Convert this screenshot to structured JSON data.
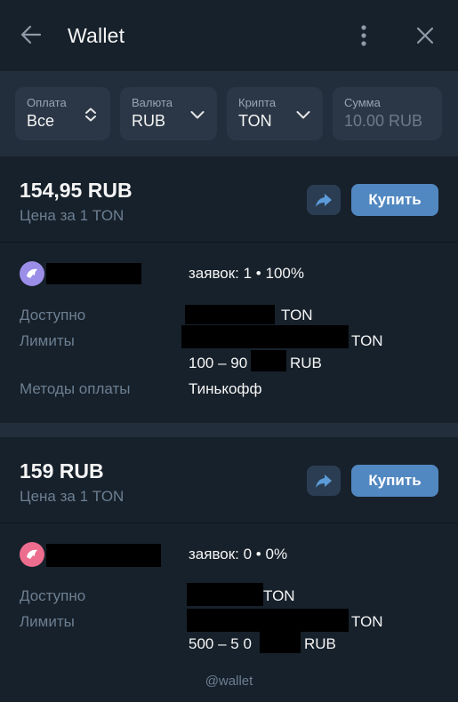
{
  "header": {
    "title": "Wallet"
  },
  "filters": [
    {
      "label": "Оплата",
      "value": "Все"
    },
    {
      "label": "Валюта",
      "value": "RUB"
    },
    {
      "label": "Крипта",
      "value": "TON"
    },
    {
      "label": "Сумма",
      "placeholder": "10.00 RUB"
    }
  ],
  "offers": [
    {
      "price": "154,95 RUB",
      "price_sub": "Цена за 1 TON",
      "buy_label": "Купить",
      "stats": "заявок: 1 • 100%",
      "available_label": "Доступно",
      "available_unit": "TON",
      "limits_label": "Лимиты",
      "limits_unit": "TON",
      "limits_range_start": "100 – 90",
      "limits_range_unit": "RUB",
      "methods_label": "Методы оплаты",
      "methods_value": "Тинькофф",
      "avatar_color": "#9b8ee8"
    },
    {
      "price": "159 RUB",
      "price_sub": "Цена за 1 TON",
      "buy_label": "Купить",
      "stats": "заявок: 0 • 0%",
      "available_label": "Доступно",
      "available_unit": "TON",
      "limits_label": "Лимиты",
      "limits_unit": "TON",
      "limits_range_start": "500 – 5 0",
      "limits_range_unit": "RUB",
      "avatar_color": "#ec6d8e"
    }
  ],
  "footer": "@wallet",
  "colors": {
    "background": "#17212b",
    "panel": "#232e3c",
    "accent": "#5288c1",
    "muted_text": "#6d7f92"
  }
}
